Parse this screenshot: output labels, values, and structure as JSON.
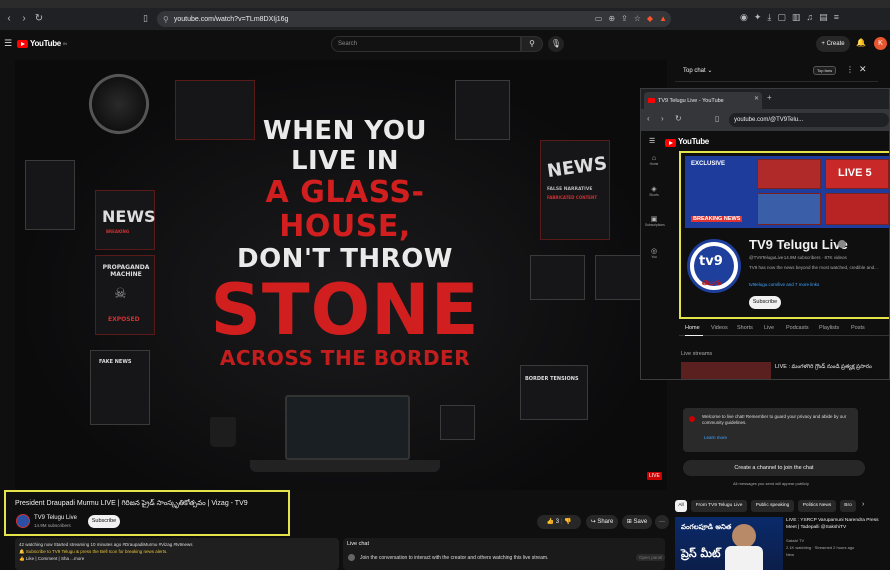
{
  "browser": {
    "url": "youtube.com/watch?v=TLm8DXIj16g"
  },
  "header": {
    "logo_text": "YouTube",
    "logo_country": "IN",
    "search_placeholder": "Search",
    "create_label": "Create",
    "avatar_letter": "K"
  },
  "player": {
    "headline_line1": "WHEN YOU",
    "headline_line2": "LIVE IN",
    "headline_line3": "A GLASS-HOUSE,",
    "headline_line4": "DON'T THROW",
    "headline_line5": "STONE",
    "headline_line6": "ACROSS THE BORDER",
    "panel_news": "NEWS",
    "panel_news_small": "BREAKING",
    "panel_propaganda": "PROPAGANDA MACHINE",
    "panel_exposed": "EXPOSED",
    "panel_news2": "NEWS",
    "panel_false": "FALSE NARRATIVE",
    "panel_fabricated": "FABRICATED CONTENT",
    "panel_border": "BORDER TENSIONS",
    "panel_fake": "FAKE NEWS",
    "live_badge": "LIVE"
  },
  "video": {
    "title": "President Draupadi Murmu LIVE | గిరిజన ప్రైడ్ సాంస్కృతికోత్సవం | Vizag - TV9",
    "channel_name": "TV9 Telugu Live",
    "channel_subs": "14.9M subscribers",
    "subscribe_label": "Subscribe",
    "like_count": "3",
    "share_label": "Share",
    "save_label": "Save",
    "more_label": "···",
    "description_line1": "42 watching now  Started streaming 10 minutes ago  #DraupadiMurmu #Vizag #tv9news",
    "description_line2": "🔔 Subscribe to TV9 Telugu & press the Bell Icon for breaking news alerts.",
    "description_line3": "👍 Like | Comment | Sha ...more"
  },
  "live_chat_bar": {
    "label": "Live chat",
    "message": "Join the conversation to interact with the creator and others watching this live stream.",
    "send_label": "Open panel"
  },
  "chat": {
    "top_label": "Top chat ⌄",
    "top_fan_badge": "Top fans",
    "welcome_text": "Welcome to live chat! Remember to guard your privacy and abide by our community guidelines.",
    "learn_more": "Learn more",
    "create_channel_button": "Create a channel to join the chat",
    "note": "All messages you send will appear publicly"
  },
  "filters": {
    "chips": [
      "All",
      "From TV9 Telugu Live",
      "Public speaking",
      "Politics News",
      "Bro"
    ]
  },
  "recommendation": {
    "thumb_line1": "వంగలపూడి అనిత",
    "thumb_line2": "ప్రెస్ మీట్",
    "title": "LIVE : YSRCP Varupamuni Narendra Press Meet | Tadepalli @SakshiTV",
    "channel": "Sakshi TV",
    "meta": "2.1K watching · Streamed 2 hours ago",
    "new_label": "New"
  },
  "popup": {
    "tab_title": "TV9 Telugu Live - YouTube",
    "url": "youtube.com/@TV9Telu...",
    "sidebar": [
      {
        "icon": "⌂",
        "label": "Home"
      },
      {
        "icon": "◈",
        "label": "Shorts"
      },
      {
        "icon": "▣",
        "label": "Subscriptions"
      },
      {
        "icon": "◎",
        "label": "You"
      }
    ],
    "banner_exclusive": "EXCLUSIVE",
    "banner_breaking": "BREAKING NEWS",
    "banner_tile_label": "LIVE 5",
    "logo_text": "tv9",
    "logo_telugu": "తెలుగు",
    "channel_title": "TV9 Telugu Live",
    "handle": "@TV9TeluguLive",
    "subs_videos": "· 14.9M subscribers · 87K videos",
    "description": "TV9 has now the news beyond the most watched, credible and...",
    "links": "tv9telugu.com/live and 7 more links",
    "subscribe_label": "Subscribe",
    "tabs": [
      "Home",
      "Videos",
      "Shorts",
      "Live",
      "Podcasts",
      "Playlists",
      "Posts"
    ],
    "streams_label": "Live streams",
    "stream_title": "LIVE : మంగళగిరి గ్రౌండ్ నుండి ప్రత్యక్ష ప్రసారం"
  }
}
